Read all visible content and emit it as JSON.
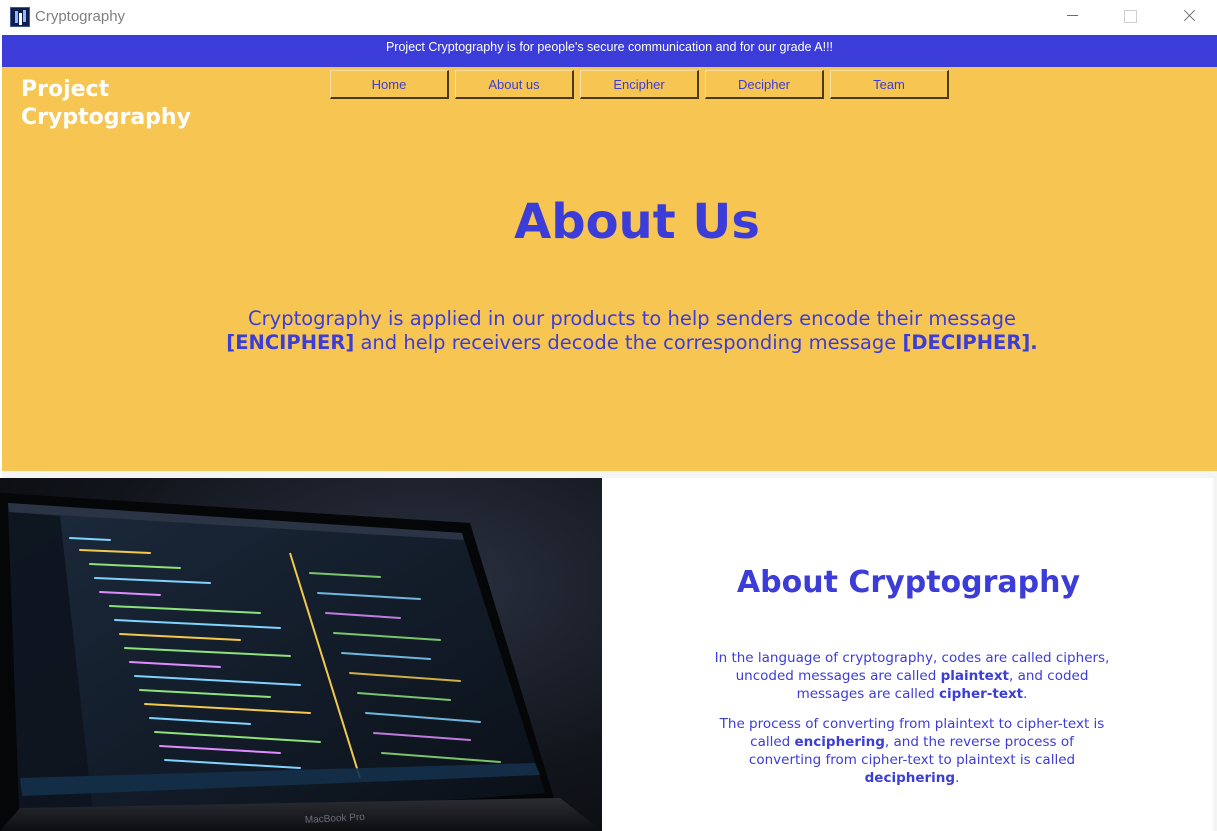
{
  "window": {
    "title": "Cryptography"
  },
  "banner": {
    "text": "Project Cryptography is for people's secure communication and for our grade A!!!"
  },
  "header": {
    "logo_line1": "Project",
    "logo_line2": "Cryptography",
    "nav": [
      {
        "label": "Home"
      },
      {
        "label": "About us"
      },
      {
        "label": "Encipher"
      },
      {
        "label": "Decipher"
      },
      {
        "label": "Team"
      }
    ]
  },
  "hero": {
    "title": "About Us",
    "text_1": "Cryptography is applied in our products to help senders encode their message",
    "bold_1": "[ENCIPHER]",
    "text_2": " and help receivers decode the corresponding message ",
    "bold_2": "[DECIPHER]."
  },
  "about": {
    "title": "About Cryptography",
    "p1": {
      "t1": "In the language of cryptography, codes are called ciphers, uncoded messages are called ",
      "b1": "plaintext",
      "t2": ", and coded messages are called ",
      "b2": "cipher-text",
      "t3": "."
    },
    "p2": {
      "t1": "The process of converting from plaintext to cipher-text is called ",
      "b1": "enciphering",
      "t2": ", and the reverse process of converting from cipher-text to plaintext is called ",
      "b2": "deciphering",
      "t3": "."
    }
  },
  "photo": {
    "laptop_label": "MacBook Pro"
  },
  "colors": {
    "accent": "#3c3cd8",
    "hero_bg": "#f7c652",
    "banner_bg": "#3c3cd8"
  }
}
